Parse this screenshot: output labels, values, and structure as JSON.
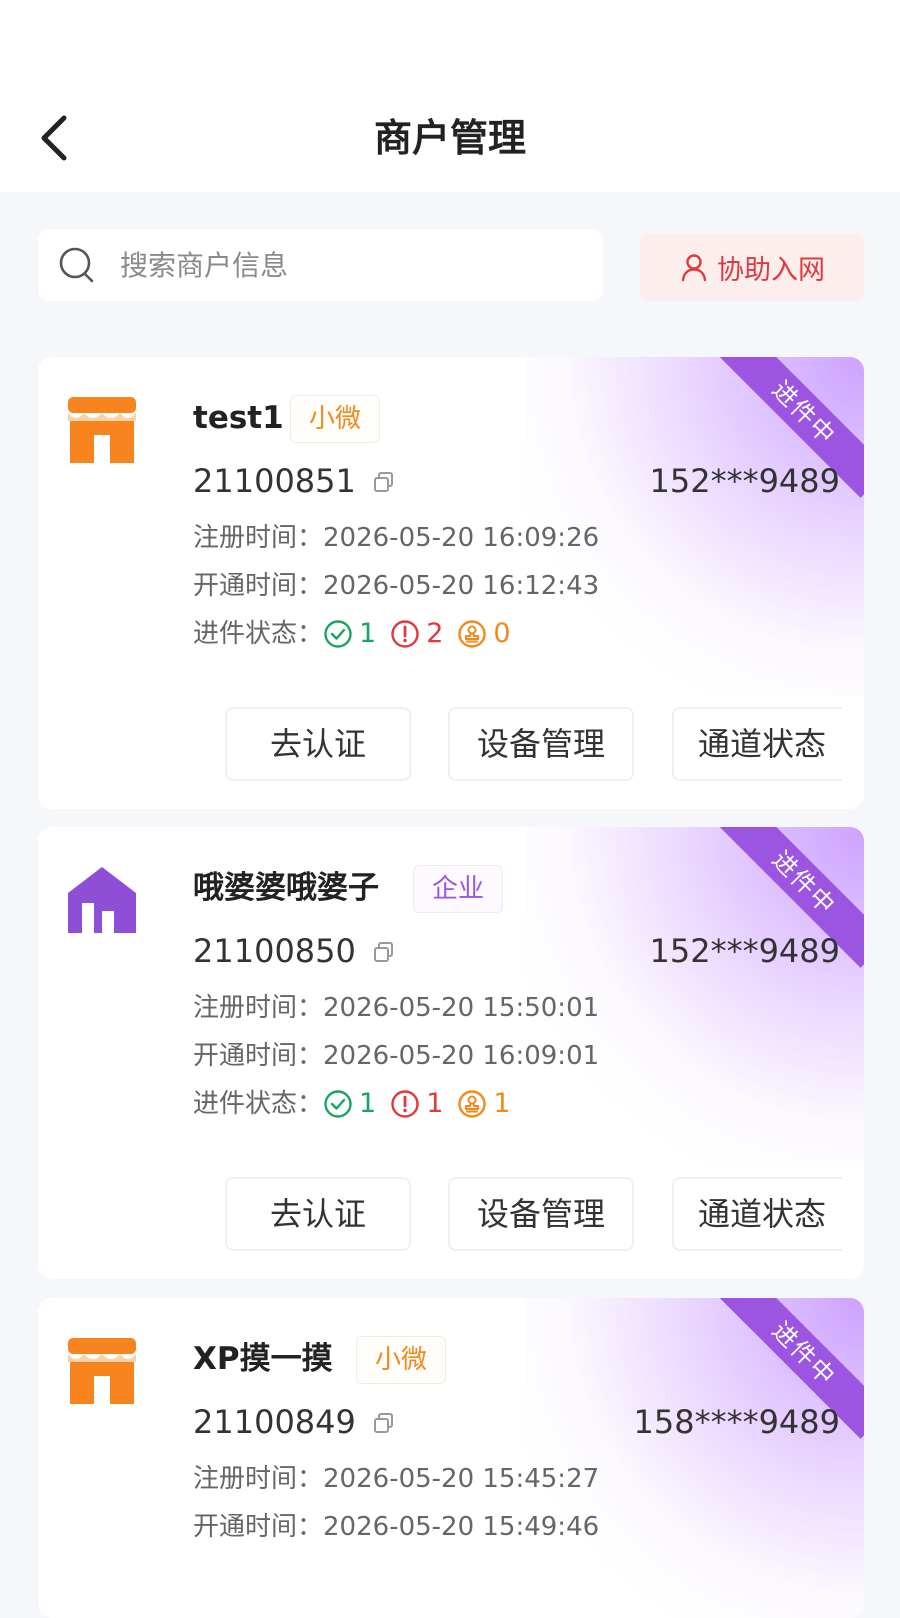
{
  "header": {
    "title": "商户管理"
  },
  "search": {
    "placeholder": "搜索商户信息"
  },
  "assist_button": {
    "label": "协助入网"
  },
  "labels": {
    "register_time": "注册时间：",
    "open_time": "开通时间：",
    "status": "进件状态："
  },
  "merchants": [
    {
      "name": "test1",
      "type": "小微",
      "icon": "store-icon",
      "id": "21100851",
      "phone": "152***9489",
      "register_time": "2026-05-20 16:09:26",
      "open_time": "2026-05-20 16:12:43",
      "status_ok": "1",
      "status_warn": "2",
      "status_pending": "0",
      "ribbon": "进件中",
      "actions": [
        "去认证",
        "设备管理",
        "通道状态"
      ]
    },
    {
      "name": "哦婆婆哦婆子",
      "type": "企业",
      "icon": "enterprise-icon",
      "id": "21100850",
      "phone": "152***9489",
      "register_time": "2026-05-20 15:50:01",
      "open_time": "2026-05-20 16:09:01",
      "status_ok": "1",
      "status_warn": "1",
      "status_pending": "1",
      "ribbon": "进件中",
      "actions": [
        "去认证",
        "设备管理",
        "通道状态"
      ]
    },
    {
      "name": "XP摸一摸",
      "type": "小微",
      "icon": "store-icon",
      "id": "21100849",
      "phone": "158****9489",
      "register_time": "2026-05-20 15:45:27",
      "open_time": "2026-05-20 15:49:46",
      "ribbon": "进件中"
    }
  ],
  "colors": {
    "accent_red": "#e0393e",
    "ok_green": "#1aa361",
    "warn_orange": "#f08a1c",
    "ribbon_purple": "#9b55e0"
  }
}
